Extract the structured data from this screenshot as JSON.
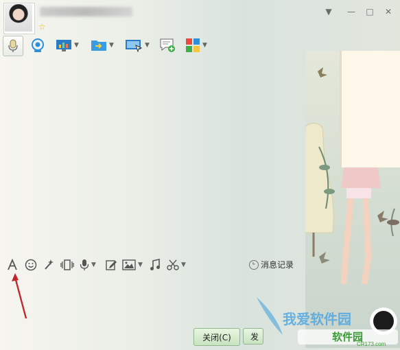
{
  "header": {
    "contact_name": "",
    "star_glyph": "☆",
    "window_buttons": {
      "dropdown": "▼",
      "minimize": "—",
      "maximize": "□",
      "close": "✕"
    }
  },
  "toolbar_top": {
    "items": [
      {
        "name": "voice",
        "icon": "microphone-icon"
      },
      {
        "name": "video",
        "icon": "webcam-icon"
      },
      {
        "name": "remote",
        "icon": "screen-chart-icon"
      },
      {
        "name": "file",
        "icon": "folder-transfer-icon"
      },
      {
        "name": "share-screen",
        "icon": "monitor-share-icon"
      },
      {
        "name": "message",
        "icon": "message-add-icon"
      },
      {
        "name": "apps",
        "icon": "apps-grid-icon"
      }
    ]
  },
  "input_toolbar": {
    "history_label": "消息记录",
    "items": [
      "font-icon",
      "emoji-icon",
      "shake-icon",
      "screenshot-icon",
      "voice-icon",
      "edit-icon",
      "image-icon",
      "music-icon",
      "scissors-icon"
    ]
  },
  "bottom": {
    "close_label": "关闭(C)",
    "send_label": "发"
  },
  "watermark": {
    "brand_cn": "我爱软件园",
    "brand_sub": "软件园",
    "domain": "CR173.com"
  },
  "colors": {
    "accent_green": "#8fb78d",
    "watermark_blue": "#4aa3e0",
    "arrow_red": "#c0272d"
  }
}
